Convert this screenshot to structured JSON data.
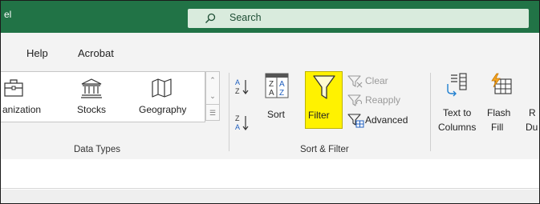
{
  "title_bar": {
    "app_name_fragment": "el",
    "search_placeholder": "Search",
    "background_color": "#217346"
  },
  "tabs": [
    {
      "label": "Help"
    },
    {
      "label": "Acrobat"
    }
  ],
  "data_types": {
    "items": [
      {
        "label": "anization",
        "icon": "organization-icon"
      },
      {
        "label": "Stocks",
        "icon": "stocks-icon"
      },
      {
        "label": "Geography",
        "icon": "geography-map-icon"
      }
    ],
    "group_label": "Data Types"
  },
  "sort_filter": {
    "sort_az_icon": "sort-a-to-z-icon",
    "sort_za_icon": "sort-z-to-a-icon",
    "sort_label": "Sort",
    "filter_label": "Filter",
    "filter_highlight_color": "#fff200",
    "clear_label": "Clear",
    "reapply_label": "Reapply",
    "advanced_label": "Advanced",
    "group_label": "Sort & Filter"
  },
  "data_tools": {
    "text_to_columns_line1": "Text to",
    "text_to_columns_line2": "Columns",
    "flash_fill_line1": "Flash",
    "flash_fill_line2": "Fill",
    "remove_dup_line1": "R",
    "remove_dup_line2": "Du"
  }
}
